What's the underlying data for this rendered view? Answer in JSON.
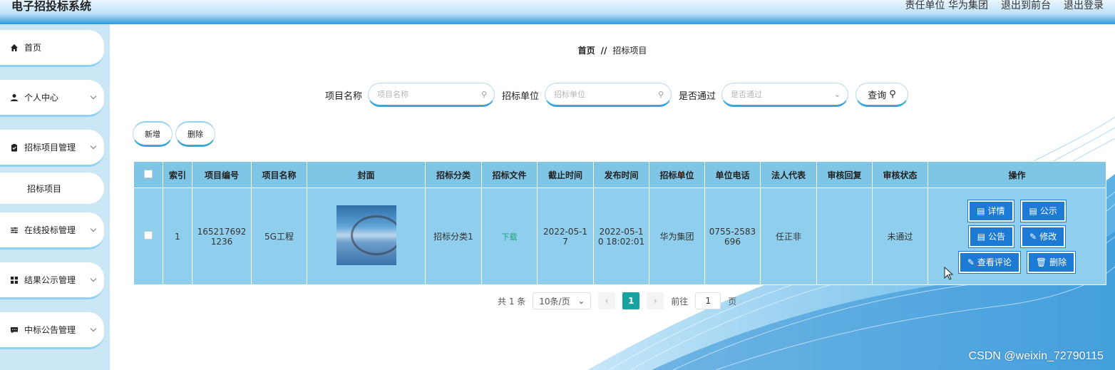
{
  "app": {
    "title": "电子招投标系统"
  },
  "topnav": {
    "unit_label": "责任单位 华为集团",
    "front": "退出到前台",
    "logout": "退出登录"
  },
  "sidebar": {
    "items": [
      {
        "label": "首页",
        "icon": "home-icon"
      },
      {
        "label": "个人中心",
        "icon": "user-icon"
      },
      {
        "label": "招标项目管理",
        "icon": "clipboard-icon"
      },
      {
        "label": "招标项目",
        "icon": ""
      },
      {
        "label": "在线投标管理",
        "icon": "sliders-icon"
      },
      {
        "label": "结果公示管理",
        "icon": "grid-icon"
      },
      {
        "label": "中标公告管理",
        "icon": "chat-icon"
      }
    ]
  },
  "breadcrumb": {
    "home": "首页",
    "sep": "//",
    "current": "招标项目"
  },
  "search": {
    "name_label": "项目名称",
    "name_placeholder": "项目名称",
    "unit_label": "招标单位",
    "unit_placeholder": "招标单位",
    "pass_label": "是否通过",
    "pass_placeholder": "是否通过",
    "button": "查询"
  },
  "actions": {
    "add": "新增",
    "delete": "删除"
  },
  "table": {
    "headers": [
      "索引",
      "项目编号",
      "项目名称",
      "封面",
      "招标分类",
      "招标文件",
      "截止时间",
      "发布时间",
      "招标单位",
      "单位电话",
      "法人代表",
      "审核回复",
      "审核状态",
      "操作"
    ],
    "row": {
      "index": "1",
      "code_l1": "165217692",
      "code_l2": "1236",
      "name": "5G工程",
      "category": "招标分类1",
      "file": "下载",
      "deadline_l1": "2022-05-1",
      "deadline_l2": "7",
      "publish_l1": "2022-05-1",
      "publish_l2": "0 18:02:01",
      "unit": "华为集团",
      "phone_l1": "0755-2583",
      "phone_l2": "696",
      "legal": "任正非",
      "reply": "",
      "status": "未通过"
    },
    "ops": {
      "detail": "详情",
      "publicity": "公示",
      "notice": "公告",
      "edit": "修改",
      "comments": "查看评论",
      "delete": "删除"
    }
  },
  "pager": {
    "total": "共 1 条",
    "size": "10条/页",
    "current": "1",
    "goto_label": "前往",
    "goto_value": "1",
    "page_unit": "页"
  },
  "watermark": "CSDN @weixin_72790115",
  "colors": {
    "accent": "#1d7bd6",
    "table_bg": "#8fceec",
    "sidebar": "#cbe6f4",
    "pager_active": "#17a2a0"
  }
}
